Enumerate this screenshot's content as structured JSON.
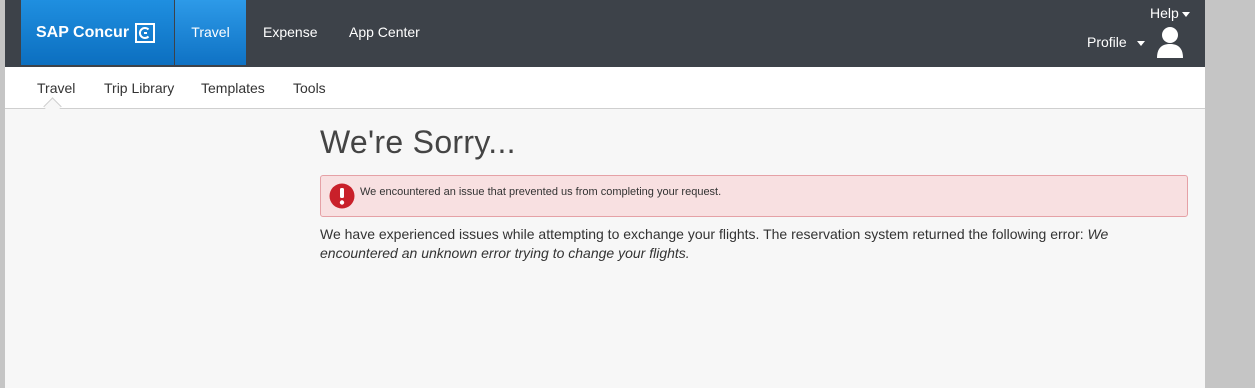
{
  "header": {
    "brand": "SAP Concur",
    "nav": [
      "Travel",
      "Expense",
      "App Center"
    ],
    "help_label": "Help",
    "profile_label": "Profile"
  },
  "subnav": {
    "items": [
      "Travel",
      "Trip Library",
      "Templates",
      "Tools"
    ],
    "active": "Travel"
  },
  "main": {
    "title": "We're Sorry...",
    "alert_text": "We encountered an issue that prevented us from completing your request.",
    "message_plain": "We have experienced issues while attempting to exchange your flights. The reservation system returned the following error: ",
    "message_italic": "We encountered an unknown error trying to change your flights."
  },
  "colors": {
    "topbar": "#3d4249",
    "brand_blue": "#0c6fc0",
    "alert_bg": "#f8e0e1",
    "alert_icon": "#c9202a"
  },
  "icons": {
    "logo": "concur-c-logo",
    "alert": "exclamation-circle-icon",
    "avatar": "user-avatar-icon"
  }
}
